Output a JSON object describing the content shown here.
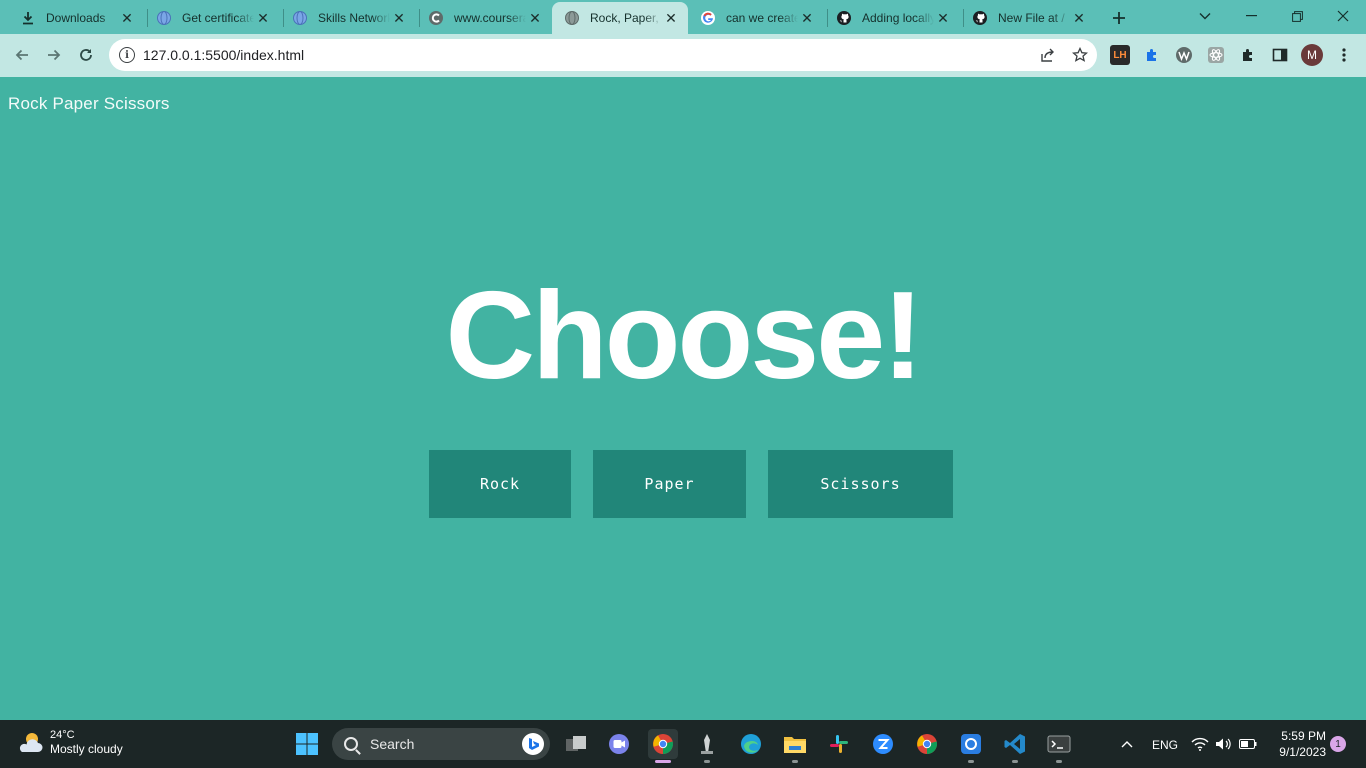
{
  "browser": {
    "tabs": [
      {
        "title": "Downloads",
        "icon": "download-icon"
      },
      {
        "title": "Get certificate",
        "icon": "globe-icon"
      },
      {
        "title": "Skills Network",
        "icon": "globe-icon"
      },
      {
        "title": "www.coursera",
        "icon": "coursera-icon"
      },
      {
        "title": "Rock, Paper, S",
        "icon": "globe-icon",
        "active": true
      },
      {
        "title": "can we create",
        "icon": "google-icon"
      },
      {
        "title": "Adding locally",
        "icon": "github-icon"
      },
      {
        "title": "New File at /",
        "icon": "github-icon"
      }
    ],
    "address": "127.0.0.1:5500/index.html",
    "profile_initial": "M",
    "ext_lh": "LH"
  },
  "page": {
    "brand": "Rock Paper Scissors",
    "headline": "Choose!",
    "choices": [
      "Rock",
      "Paper",
      "Scissors"
    ]
  },
  "taskbar": {
    "weather_temp": "24°C",
    "weather_condition": "Mostly cloudy",
    "search_placeholder": "Search",
    "language": "ENG",
    "time": "5:59 PM",
    "date": "9/1/2023",
    "notifications": "1"
  },
  "colors": {
    "page_bg": "#42b3a2",
    "button_bg": "#218679",
    "tabstrip_bg": "#5bbfb7",
    "toolbar_bg": "#c2e7e3",
    "taskbar_bg": "#1c2626"
  }
}
